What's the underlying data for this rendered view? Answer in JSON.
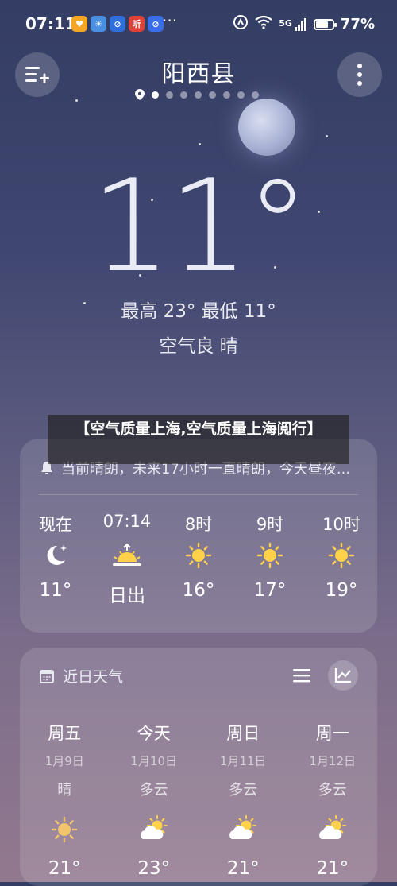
{
  "status": {
    "time": "07:11",
    "more": "···",
    "network": "5G",
    "battery": "77%",
    "battery_level": 0.77
  },
  "header": {
    "city": "阳西县",
    "page_count": 8,
    "active_page": 0
  },
  "current": {
    "temp": "11°",
    "hilo": "最高 23° 最低 11°",
    "condition": "空气良  晴"
  },
  "overlay": {
    "title": "【空气质量上海,空气质量上海阅行】"
  },
  "hourly": {
    "alert": "当前晴朗，未来17小时一直晴朗，今天昼夜...",
    "items": [
      {
        "label": "现在",
        "icon": "moon-night-icon",
        "value": "11°"
      },
      {
        "label": "07:14",
        "icon": "sunrise-icon",
        "value": "日出"
      },
      {
        "label": "8时",
        "icon": "sun-icon",
        "value": "16°"
      },
      {
        "label": "9时",
        "icon": "sun-icon",
        "value": "17°"
      },
      {
        "label": "10时",
        "icon": "sun-icon",
        "value": "19°"
      }
    ]
  },
  "daily": {
    "title": "近日天气",
    "items": [
      {
        "name": "周五",
        "date": "1月9日",
        "cond": "晴",
        "icon": "sun-dim-icon",
        "value": "21°"
      },
      {
        "name": "今天",
        "date": "1月10日",
        "cond": "多云",
        "icon": "partly-cloudy-icon",
        "value": "23°"
      },
      {
        "name": "周日",
        "date": "1月11日",
        "cond": "多云",
        "icon": "partly-cloudy-icon",
        "value": "21°"
      },
      {
        "name": "周一",
        "date": "1月12日",
        "cond": "多云",
        "icon": "partly-cloudy-icon",
        "value": "21°"
      }
    ]
  },
  "colors": {
    "sun": "#ffd24a",
    "app1": "#f5a623",
    "app2": "#4a90e2",
    "app3": "#2f6fdc",
    "app4": "#e0423a",
    "app5": "#3a6ee8"
  }
}
